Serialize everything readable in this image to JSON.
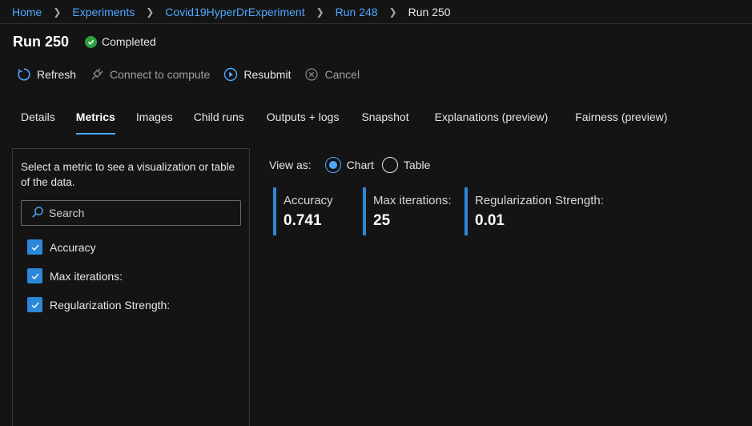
{
  "breadcrumb": {
    "items": [
      "Home",
      "Experiments",
      "Covid19HyperDrExperiment",
      "Run 248"
    ],
    "current": "Run 250"
  },
  "header": {
    "title": "Run 250",
    "status": "Completed"
  },
  "toolbar": {
    "refresh": "Refresh",
    "connect": "Connect to compute",
    "resubmit": "Resubmit",
    "cancel": "Cancel"
  },
  "tabs": [
    "Details",
    "Metrics",
    "Images",
    "Child runs",
    "Outputs + logs",
    "Snapshot",
    "Explanations (preview)",
    "Fairness (preview)"
  ],
  "active_tab": "Metrics",
  "sidebar": {
    "description": "Select a metric to see a visualization or table of the data.",
    "search_placeholder": "Search",
    "metrics": [
      "Accuracy",
      "Max iterations:",
      "Regularization Strength:"
    ]
  },
  "view_as": {
    "label": "View as:",
    "options": [
      "Chart",
      "Table"
    ],
    "selected": "Chart"
  },
  "cards": [
    {
      "label": "Accuracy",
      "value": "0.741"
    },
    {
      "label": "Max iterations:",
      "value": "25"
    },
    {
      "label": "Regularization Strength:",
      "value": "0.01"
    }
  ],
  "colors": {
    "accent": "#4ea7ff",
    "checkbox": "#2b88d8",
    "success": "#2ea043",
    "background": "#141414"
  }
}
